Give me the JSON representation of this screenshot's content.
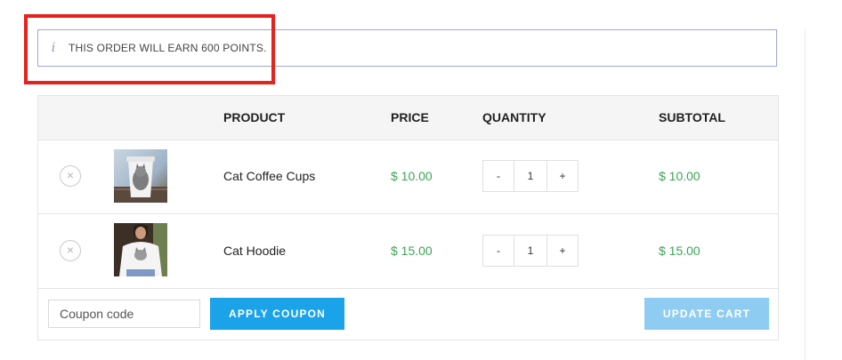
{
  "notice": {
    "message": "THIS ORDER WILL EARN 600 POINTS.",
    "icon": "info-icon"
  },
  "cart": {
    "columns": {
      "product": "PRODUCT",
      "price": "PRICE",
      "quantity": "QUANTITY",
      "subtotal": "SUBTOTAL"
    },
    "items": [
      {
        "name": "Cat Coffee Cups",
        "price": "$ 10.00",
        "quantity": "1",
        "subtotal": "$ 10.00"
      },
      {
        "name": "Cat Hoodie",
        "price": "$ 15.00",
        "quantity": "1",
        "subtotal": "$ 15.00"
      }
    ],
    "controls": {
      "remove": "×",
      "decrease": "-",
      "increase": "+"
    }
  },
  "actions": {
    "coupon_placeholder": "Coupon code",
    "apply_label": "APPLY COUPON",
    "update_label": "UPDATE CART"
  },
  "colors": {
    "accent": "#1aa3e8",
    "accent_disabled": "#8ecdf1",
    "price_green": "#3aa655",
    "highlight_red": "#e5221d",
    "notice_border": "#9fa6d8"
  }
}
